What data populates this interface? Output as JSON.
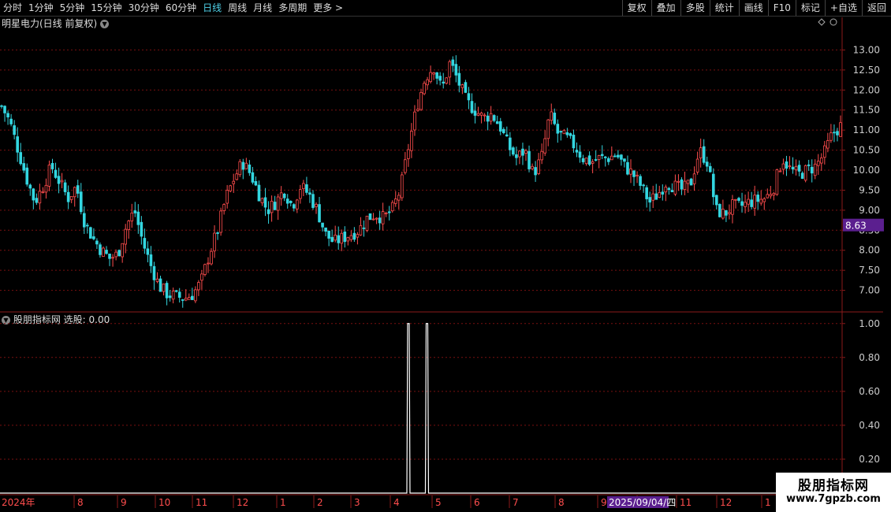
{
  "toolbar": {
    "periods": [
      {
        "label": "分时",
        "active": false
      },
      {
        "label": "1分钟",
        "active": false
      },
      {
        "label": "5分钟",
        "active": false
      },
      {
        "label": "15分钟",
        "active": false
      },
      {
        "label": "30分钟",
        "active": false
      },
      {
        "label": "60分钟",
        "active": false
      },
      {
        "label": "日线",
        "active": true
      },
      {
        "label": "周线",
        "active": false
      },
      {
        "label": "月线",
        "active": false
      },
      {
        "label": "多周期",
        "active": false
      },
      {
        "label": "更多 >",
        "active": false
      }
    ],
    "actions": [
      "复权",
      "叠加",
      "多股",
      "统计",
      "画线",
      "F10",
      "标记",
      "+自选",
      "返回"
    ]
  },
  "main_panel": {
    "title": "明星电力(日线 前复权)",
    "current_price_tag": "8.63"
  },
  "indicator_panel": {
    "title": "股朋指标网 选股: 0.00"
  },
  "date_axis": {
    "start_label": "2024年",
    "months": [
      "8",
      "9",
      "10",
      "11",
      "12",
      "1",
      "2",
      "3",
      "4",
      "5",
      "6",
      "7",
      "8",
      "9",
      "10",
      "11",
      "12",
      "1"
    ],
    "cursor_date": "2025/09/04/四"
  },
  "watermark": {
    "title": "股朋指标网",
    "url": "www.7gpzb.com"
  },
  "colors": {
    "up": "#ff4d4d",
    "down": "#33d6e0",
    "grid": "#7a1010",
    "axis": "#8b1a1a",
    "price_tag_bg": "#5b1f8f",
    "active_period": "#4fd1e8"
  },
  "chart_data": [
    {
      "type": "candlestick",
      "ylim": [
        6.5,
        13.5
      ],
      "yticks": [
        7.0,
        7.5,
        8.0,
        8.5,
        9.0,
        9.5,
        10.0,
        10.5,
        11.0,
        11.5,
        12.0,
        12.5,
        13.0
      ],
      "close_path": [
        11.6,
        11.2,
        10.5,
        9.8,
        9.2,
        9.6,
        10.1,
        9.7,
        9.3,
        9.6,
        8.7,
        8.3,
        8.0,
        7.8,
        7.9,
        8.6,
        9.0,
        8.2,
        7.6,
        7.1,
        6.9,
        6.85,
        6.8,
        6.9,
        7.2,
        7.9,
        8.5,
        9.3,
        9.8,
        10.2,
        9.9,
        9.4,
        9.0,
        9.2,
        9.5,
        9.1,
        9.6,
        9.4,
        9.0,
        8.4,
        8.2,
        8.3,
        8.4,
        8.5,
        8.8,
        8.9,
        8.8,
        9.0,
        9.5,
        10.6,
        11.6,
        12.3,
        12.6,
        12.0,
        12.7,
        12.2,
        11.7,
        11.5,
        11.3,
        11.4,
        11.1,
        10.6,
        10.3,
        10.5,
        9.9,
        10.3,
        11.4,
        10.9,
        10.8,
        10.6,
        10.3,
        10.2,
        10.3,
        10.3,
        10.4,
        10.1,
        9.9,
        9.6,
        9.2,
        9.4,
        9.7,
        9.6,
        9.5,
        9.7,
        10.5,
        10.2,
        9.0,
        8.9,
        9.1,
        9.1,
        9.2,
        9.25,
        9.3,
        9.6,
        10.3,
        10.0,
        9.9,
        10.0,
        10.1,
        10.4,
        10.9,
        11.1
      ],
      "series": [
        {
          "name": "",
          "note": "",
          "values": []
        }
      ]
    },
    {
      "type": "line",
      "ylim": [
        0,
        1.05
      ],
      "yticks": [
        0.2,
        0.4,
        0.6,
        0.8,
        1.0
      ],
      "signal_positions": [
        0.485,
        0.507
      ],
      "values": [
        0,
        1,
        0,
        1,
        0
      ]
    }
  ]
}
